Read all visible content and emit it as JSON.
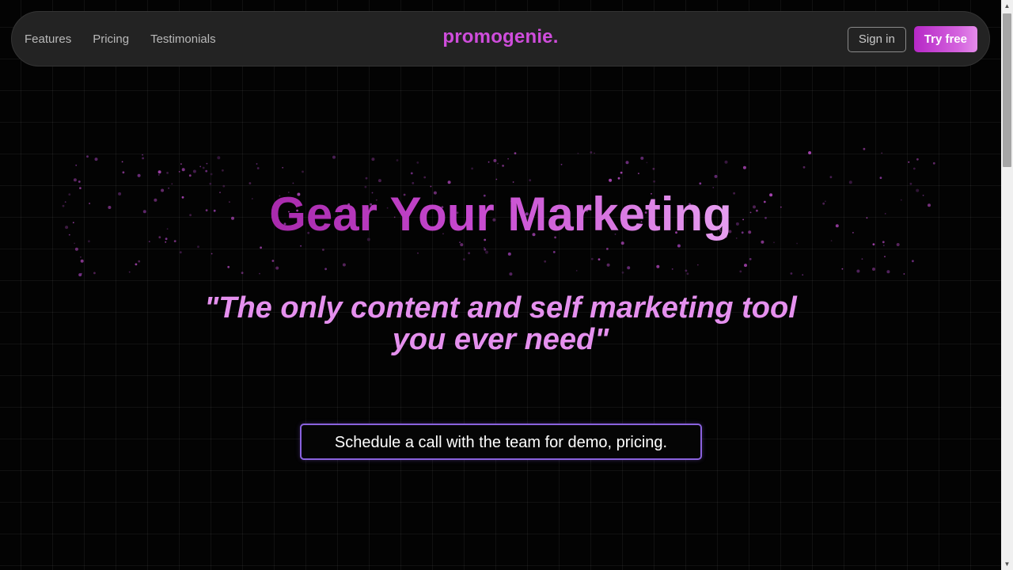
{
  "nav": {
    "links": [
      "Features",
      "Pricing",
      "Testimonials"
    ],
    "brand": "promogenie.",
    "signin_label": "Sign in",
    "try_label": "Try free"
  },
  "hero": {
    "title": "Gear Your Marketing",
    "tagline": "\"The only content and self marketing tool you ever need\"",
    "cta_label": "Schedule a call with the team for demo, pricing."
  },
  "colors": {
    "background": "#030303",
    "brand": "#cf4ddc",
    "accent": "#c54bd4",
    "tagline": "#e590ee",
    "cta_border": "#8a62de"
  },
  "scrollbar": {
    "up_icon": "scroll-up-arrow-icon",
    "down_icon": "scroll-down-arrow-icon"
  }
}
